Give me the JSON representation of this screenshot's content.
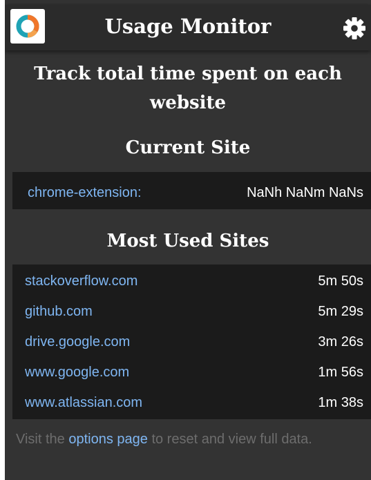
{
  "app": {
    "title": "Usage Monitor",
    "logo_icon": "ring-logo-icon",
    "settings_icon": "gear-icon"
  },
  "tagline": "Track total time spent on each website",
  "current_site": {
    "heading": "Current Site",
    "name": "chrome-extension:",
    "time": "NaNh NaNm NaNs"
  },
  "most_used": {
    "heading": "Most Used Sites",
    "sites": [
      {
        "name": "stackoverflow.com",
        "time": "5m 50s"
      },
      {
        "name": "github.com",
        "time": "5m 29s"
      },
      {
        "name": "drive.google.com",
        "time": "3m 26s"
      },
      {
        "name": "www.google.com",
        "time": "1m 56s"
      },
      {
        "name": "www.atlassian.com",
        "time": "1m 38s"
      }
    ]
  },
  "footer": {
    "prefix": "Visit the ",
    "link": "options page",
    "suffix": " to reset and view full data."
  },
  "colors": {
    "background": "#333333",
    "header": "#2b2b2b",
    "panel": "#1b1b1b",
    "link": "#7fb6f2",
    "muted_text": "#6d6d6d",
    "logo_orange": "#f0762a",
    "logo_teal": "#1fa3b5"
  }
}
